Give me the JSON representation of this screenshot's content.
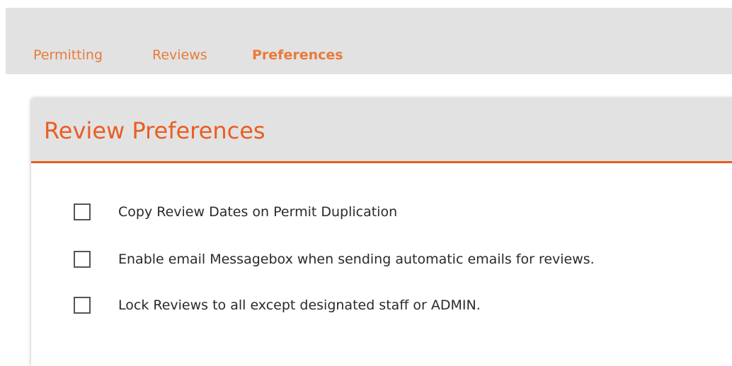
{
  "nav": {
    "tabs": [
      {
        "label": "Permitting"
      },
      {
        "label": "Reviews"
      },
      {
        "label": "Preferences"
      }
    ],
    "active_tab": "Preferences"
  },
  "panel": {
    "title": "Review Preferences",
    "options": [
      {
        "label": "Copy Review Dates on Permit Duplication",
        "checked": false
      },
      {
        "label": "Enable email Messagebox when sending automatic emails for reviews.",
        "checked": false
      },
      {
        "label": "Lock Reviews to all except designated staff or ADMIN.",
        "checked": false
      }
    ]
  },
  "colors": {
    "accent": "#ea5d22",
    "nav_text": "#ea7a3a",
    "header_bg": "#e2e2e2",
    "text": "#2a2a2a"
  }
}
